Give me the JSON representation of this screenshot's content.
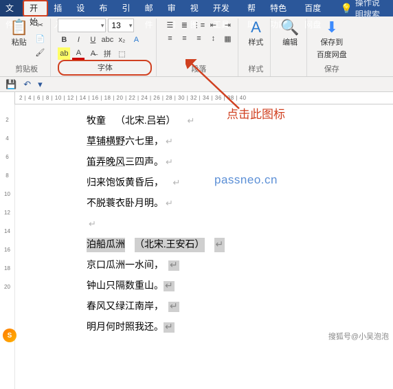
{
  "tabs": {
    "file": "文件",
    "home": "开始",
    "insert": "插入",
    "design": "设计",
    "layout": "布局",
    "references": "引用",
    "mailings": "邮件",
    "review": "审阅",
    "view": "视图",
    "developer": "开发工具",
    "help": "帮助",
    "special": "特色功能",
    "netdisk": "百度网盘",
    "tell_me": "操作说明搜索"
  },
  "ribbon": {
    "clipboard": {
      "paste": "粘贴",
      "label": "剪贴板"
    },
    "font": {
      "family": "",
      "size": "13",
      "label": "字体"
    },
    "paragraph": {
      "label": "段落"
    },
    "styles": {
      "label": "样式"
    },
    "editing": {
      "label": "编辑"
    },
    "save": {
      "save_to": "保存到",
      "netdisk": "百度网盘",
      "label": "保存"
    }
  },
  "annotation": {
    "callout": "点击此图标"
  },
  "watermark": "passneo.cn",
  "document": {
    "poem1_title": "牧童",
    "poem1_author": "（北宋.吕岩）",
    "poem1_l1a": "草铺横野",
    "poem1_l1b": "六七里，",
    "poem1_l2a": "笛弄晚风",
    "poem1_l2b": "三四声。",
    "poem1_l3": "归来饱饭黄昏后，",
    "poem1_l4": "不脱蓑衣卧月明。",
    "poem2_title": "泊船瓜洲",
    "poem2_author": "（北宋.王安石）",
    "poem2_l1": "京口瓜洲一水间，",
    "poem2_l2": "钟山只隔数重山。",
    "poem2_l3": "春风又绿江南岸，",
    "poem2_l4": "明月何时照我还。"
  },
  "ruler_h": "2   |   4   |   6   |   8   |  10  |  12  |  14  |  16  |  18  |  20  |  22  |  24  |  26  |  28  |  30  |  32  |  34  |  36  |  38  |  40",
  "footer": {
    "source": "搜狐号@小吴泡泡",
    "logo": "S"
  }
}
